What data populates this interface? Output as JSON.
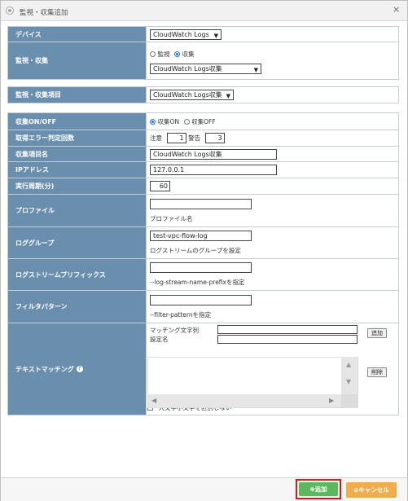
{
  "dialog": {
    "title": "監視・収集追加",
    "close": "×"
  },
  "device": {
    "label": "デバイス",
    "value": "CloudWatch Logs"
  },
  "monitor": {
    "label": "監視・収集",
    "option_monitor": "監視",
    "option_collect": "収集",
    "selected": "collect",
    "select_value": "CloudWatch Logs収集"
  },
  "item": {
    "label": "監視・収集項目",
    "value": "CloudWatch Logs収集"
  },
  "collect_onoff": {
    "label": "収集ON/OFF",
    "on": "収集ON",
    "off": "収集OFF",
    "selected": "on"
  },
  "error_count": {
    "label": "取得エラー判定回数",
    "caution_label": "注意",
    "caution_value": "1",
    "warning_label": "警告",
    "warning_value": "3"
  },
  "item_name": {
    "label": "収集項目名",
    "value": "CloudWatch Logs収集"
  },
  "ip": {
    "label": "IPアドレス",
    "value": "127.0.0.1"
  },
  "interval": {
    "label": "実行周期(分)",
    "value": "60"
  },
  "profile": {
    "label": "プロファイル",
    "value": "",
    "hint": "プロファイル名"
  },
  "log_group": {
    "label": "ロググループ",
    "value": "test-vpc-flow-log",
    "hint": "ログストリームのグループを設定"
  },
  "stream_prefix": {
    "label": "ログストリームプリフィックス",
    "value": "",
    "hint": "--log-stream-name-prefixを指定"
  },
  "filter": {
    "label": "フィルタパターン",
    "value": "",
    "hint": "--filter-patternを指定"
  },
  "text_matching": {
    "label": "テキストマッチング",
    "help": "?",
    "match_label": "マッチング文字列",
    "setting_label": "設定名",
    "add_button": "追加",
    "delete_button": "削除",
    "case_checkbox": "大文字小文字を区別しない"
  },
  "footer": {
    "add": "追加",
    "cancel": "キャンセル"
  },
  "colors": {
    "label_bg": "#6a8ead",
    "add_bg": "#5cb85c",
    "cancel_bg": "#f0ad4e",
    "highlight": "#e0141a"
  }
}
